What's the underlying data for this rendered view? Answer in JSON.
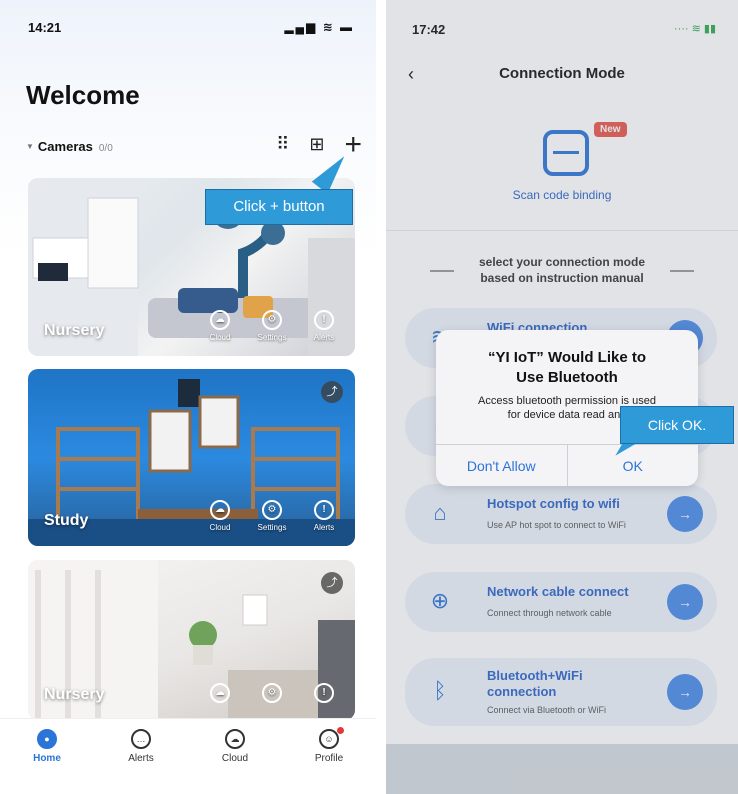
{
  "left": {
    "status": {
      "time": "14:21",
      "icons": "▂▄▆ ≋ ▬"
    },
    "title": "Welcome",
    "cameras_header": {
      "label": "Cameras",
      "count": "0/0"
    },
    "cards": [
      {
        "name": "Nursery",
        "actions": [
          "Cloud",
          "Settings",
          "Alerts"
        ]
      },
      {
        "name": "Study",
        "actions": [
          "Cloud",
          "Settings",
          "Alerts"
        ]
      },
      {
        "name": "Nursery",
        "actions": [
          "Cloud",
          "Settings",
          "Alerts"
        ]
      }
    ],
    "tabs": [
      "Home",
      "Alerts",
      "Cloud",
      "Profile"
    ],
    "callout": "Click + button"
  },
  "right": {
    "status": {
      "time": "17:42",
      "icons": "···· ≋ ▮▮"
    },
    "nav_title": "Connection Mode",
    "scan": {
      "badge": "New",
      "label": "Scan code binding"
    },
    "hint": [
      "select your connection mode",
      "based on instruction manual"
    ],
    "modes": [
      {
        "title": "WiFi connection",
        "subtitle": ""
      },
      {
        "title": "",
        "subtitle": ""
      },
      {
        "title": "Hotspot config to wifi",
        "subtitle": "Use AP hot spot to connect to WiFi"
      },
      {
        "title": "Network cable connect",
        "subtitle": "Connect through network cable"
      },
      {
        "title": "Bluetooth+WiFi",
        "title2": "connection",
        "subtitle": "Connect via Bluetooth or WiFi"
      }
    ],
    "alert": {
      "title_line1": "“YI IoT” Would Like to",
      "title_line2": "Use Bluetooth",
      "message_line1": "Access bluetooth permission is used",
      "message_line2": "for device data read and",
      "deny": "Don't Allow",
      "ok": "OK"
    },
    "callout": "Click OK."
  },
  "colors": {
    "accent": "#2b74d8",
    "callout": "#2f9ad8",
    "badge": "#e8574a"
  }
}
